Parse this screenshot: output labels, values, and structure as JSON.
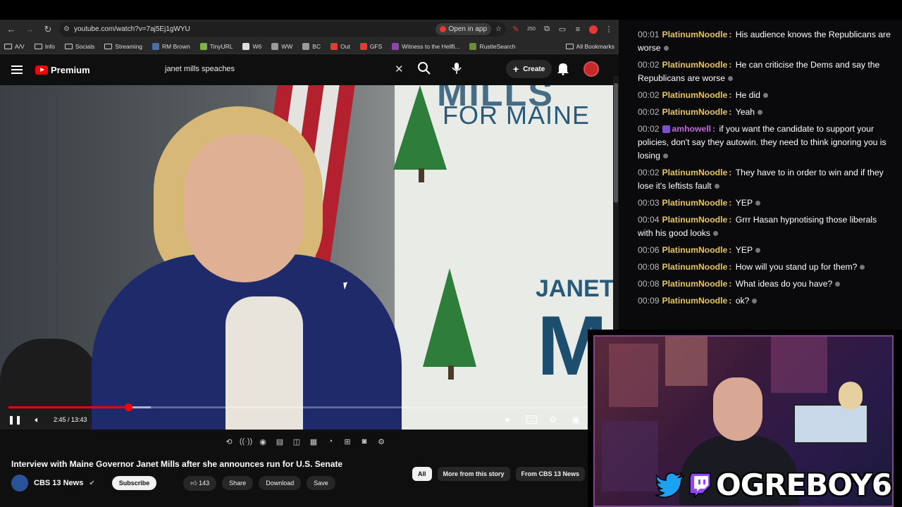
{
  "browser": {
    "url": "youtube.com/watch?v=7aj5Ej1gWYU",
    "open_in_app": "Open in app",
    "bookmarks": [
      "A/V",
      "Info",
      "Socials",
      "Streaming",
      "RM Brown",
      "TinyURL",
      "W6",
      "WW",
      "BC",
      "Out",
      "GFS",
      "Witness to the Hellfi...",
      "RustleSearch"
    ],
    "all_bookmarks": "All Bookmarks",
    "ext_badge": "250"
  },
  "youtube": {
    "logo_text": "Premium",
    "search_value": "janet mills speaches",
    "create_label": "Create",
    "video": {
      "banner_line1": "MILLS",
      "banner_line2": "FOR MAINE",
      "banner_line3": "JANET",
      "banner_line4": "MI",
      "time": "2:45 / 13:43",
      "progress_fraction": 0.2,
      "buffer_fraction": 0.238
    },
    "title": "Interview with Maine Governor Janet Mills after she announces run for U.S. Senate",
    "channel": "CBS 13 News",
    "subscribe": "Subscribe",
    "likes": "143",
    "share": "Share",
    "download": "Download",
    "save": "Save",
    "chips": [
      "All",
      "More from this story",
      "From CBS 13 News"
    ]
  },
  "chat": {
    "messages": [
      {
        "ts": "00:01",
        "user": "PlatinumNoodle",
        "color": "#e6c55a",
        "text": "His audience knows the Republicans are worse"
      },
      {
        "ts": "00:02",
        "user": "PlatinumNoodle",
        "color": "#e6c55a",
        "text": "He can criticise the Dems and say the Republicans are worse"
      },
      {
        "ts": "00:02",
        "user": "PlatinumNoodle",
        "color": "#e6c55a",
        "text": "He did"
      },
      {
        "ts": "00:02",
        "user": "PlatinumNoodle",
        "color": "#e6c55a",
        "text": "Yeah"
      },
      {
        "ts": "00:02",
        "user": "amhowell",
        "color": "#c06ad8",
        "badge": true,
        "text": "if you want the candidate to support your policies, don't say they autowin. they need to think ignoring you is losing"
      },
      {
        "ts": "00:02",
        "user": "PlatinumNoodle",
        "color": "#e6c55a",
        "text": "They have to in order to win and if they lose it's leftists fault"
      },
      {
        "ts": "00:03",
        "user": "PlatinumNoodle",
        "color": "#e6c55a",
        "text": "YEP"
      },
      {
        "ts": "00:04",
        "user": "PlatinumNoodle",
        "color": "#e6c55a",
        "text": "Grrr Hasan hypnotising those liberals with his good looks"
      },
      {
        "ts": "00:06",
        "user": "PlatinumNoodle",
        "color": "#e6c55a",
        "text": "YEP"
      },
      {
        "ts": "00:08",
        "user": "PlatinumNoodle",
        "color": "#e6c55a",
        "text": "How will you stand up for them?"
      },
      {
        "ts": "00:08",
        "user": "PlatinumNoodle",
        "color": "#e6c55a",
        "text": "What ideas do you have?"
      },
      {
        "ts": "00:09",
        "user": "PlatinumNoodle",
        "color": "#e6c55a",
        "text": "ok?"
      }
    ]
  },
  "overlay": {
    "handle": "OGREBOY6",
    "icons": [
      "twitter-icon",
      "twitch-icon"
    ]
  }
}
